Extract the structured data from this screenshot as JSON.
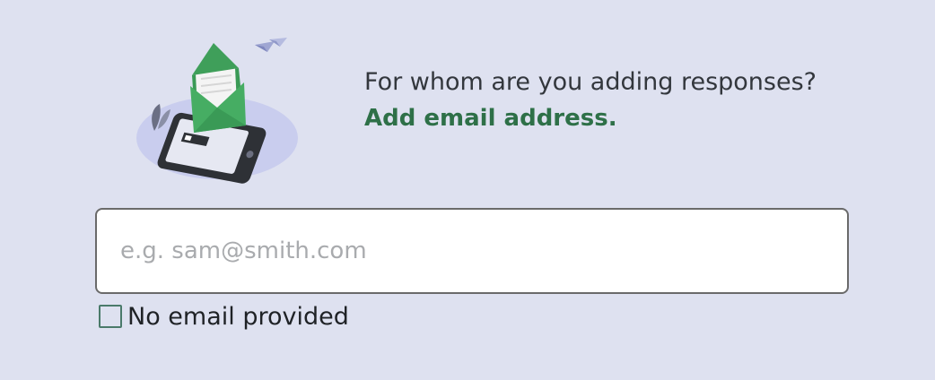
{
  "prompt": {
    "question": "For whom are you adding responses?",
    "action": "Add email address."
  },
  "email_input": {
    "value": "",
    "placeholder": "e.g. sam@smith.com"
  },
  "no_email_checkbox": {
    "label": "No email provided",
    "checked": false
  },
  "illustration": {
    "icon": "phone-with-envelope-illustration"
  },
  "colors": {
    "background": "#dee1f0",
    "accent_green": "#2e7048",
    "text_dark": "#33373d",
    "input_border": "#6a6a6a",
    "placeholder": "#a9abae",
    "checkbox_border": "#4a7a6a"
  }
}
